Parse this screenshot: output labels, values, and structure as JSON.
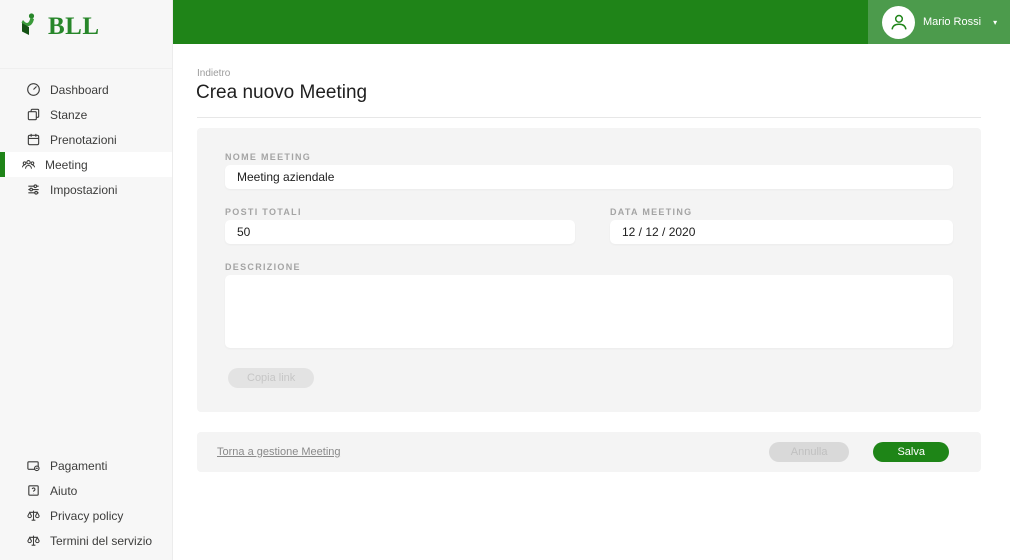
{
  "brand": {
    "name": "BLL"
  },
  "header": {
    "user_name": "Mario Rossi",
    "caret": "▾"
  },
  "sidebar": {
    "items": [
      {
        "label": "Dashboard",
        "icon": "dashboard-icon"
      },
      {
        "label": "Stanze",
        "icon": "rooms-icon"
      },
      {
        "label": "Prenotazioni",
        "icon": "calendar-icon"
      },
      {
        "label": "Meeting",
        "icon": "people-icon",
        "active": true
      },
      {
        "label": "Impostazioni",
        "icon": "sliders-icon"
      }
    ],
    "footer_items": [
      {
        "label": "Pagamenti",
        "icon": "credit-card-icon"
      },
      {
        "label": "Aiuto",
        "icon": "help-icon"
      },
      {
        "label": "Privacy policy",
        "icon": "scales-icon"
      },
      {
        "label": "Termini del servizio",
        "icon": "scales-icon"
      }
    ]
  },
  "main": {
    "back_label": "Indietro",
    "title": "Crea nuovo Meeting",
    "form": {
      "nome_meeting": {
        "label": "NOME MEETING",
        "value": "Meeting aziendale"
      },
      "posti_totali": {
        "label": "POSTI TOTALI",
        "value": "50"
      },
      "data_meeting": {
        "label": "DATA MEETING",
        "value": "12 / 12 / 2020"
      },
      "descrizione": {
        "label": "DESCRIZIONE",
        "value": ""
      },
      "copy_link_label": "Copia link"
    },
    "footer": {
      "back_link": "Torna a gestione Meeting",
      "cancel_label": "Annulla",
      "save_label": "Salva"
    }
  },
  "colors": {
    "header_green": "#1f8418",
    "user_area_green": "#4c9b4c",
    "save_green": "#1e8517",
    "sidebar_bg": "#f7f7f7",
    "panel_bg": "#f4f4f4",
    "logo_green": "#27862a"
  }
}
